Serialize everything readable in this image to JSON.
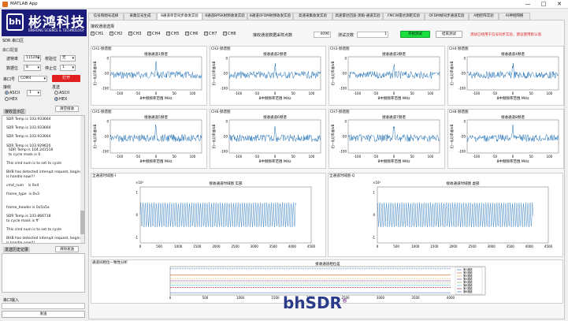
{
  "window": {
    "title": "MATLAB App",
    "minimize": "—",
    "maximize": "□",
    "close": "✕"
  },
  "logo": {
    "mark": "bh",
    "name_cn": "彬鸿科技",
    "name_en": "BINHONG SCIENCE & TECHNOLOGY"
  },
  "sidebar": {
    "section_title": "SDR 串口区",
    "serial_settings": "串口配置",
    "baud_label": "波特率",
    "baud_value": "115200",
    "parity_label": "校验位",
    "parity_value": "无",
    "databits_label": "数据位",
    "databits_value": "8",
    "stopbits_label": "停止位",
    "stopbits_value": "1",
    "port_label": "串口号",
    "port_value": "COM4",
    "open_button": "打开",
    "receive_label": "接收",
    "send_mode_label": "发送",
    "ascii_label": "ASCII",
    "hex_label": "HEX",
    "count_value": "1",
    "clear_button": "清空接收",
    "recv_area_title": "接收显示区",
    "log_lines": [
      "SDR Temp is 103.933664",
      "",
      "SDR Temp is 103.933664",
      "",
      "SDR Temp is 103.933664",
      "",
      "SDR Temp is 103.929620",
      "  SDR Temp is 104.241516",
      "  tx cycle mask is 0",
      "",
      "This cmd num is to set tx cycle",
      "",
      "BHB has detected interupt request, begin",
      "is handle now!!!",
      "",
      "cmd_num    is 0x4",
      "",
      "frame_type  is 0x3",
      "",
      "",
      "frame_header is 0x5a5a",
      "",
      "SDR Temp is 103.866718",
      "tx cycle mask is ff",
      "",
      "This cmd num is to set tx cycle",
      "",
      "BHB has detected interupt request, begin",
      "is handle now!!!",
      "",
      "cmd_num    is 0x4"
    ],
    "send_area_title": "发送历史记录",
    "clear_send_button": "清除发送",
    "input_label": "串口输入",
    "send_button": "发送"
  },
  "tabs": [
    "信号和图号选择",
    "采集信号生成",
    "8通道单音同步收发实验",
    "8通道BPSK射频收发实验",
    "8通道OFDM射频收发实验",
    "高速采集收发实验",
    "高速雷达回波-测角-通道实验",
    "FMCW雷达测距实验",
    "OFDM帧同步通道实验",
    "A相控阵实验",
    "AI神经网络"
  ],
  "active_tab": 2,
  "controls": {
    "channel_group": "接收通道选择",
    "channels": [
      "CH1",
      "CH2",
      "CH3",
      "CH4",
      "CH5",
      "CH6",
      "CH7",
      "CH8"
    ],
    "rate_label": "接收通道数据采样点数",
    "rate_value": "4096",
    "count_label": "测试次数",
    "count_value": "1",
    "start_button": "开始测试",
    "stop_button": "结束测试",
    "status_text": "测试已经用于信号同步实验，建议使用默认值"
  },
  "spectrum": {
    "ylabel": "归一化功率谱/dB",
    "xlabel": "8中频频率范围 MHz",
    "xticks": [
      "-100",
      "-50",
      "0",
      "50",
      "100"
    ],
    "yticks": [
      "0",
      "-50",
      "-100"
    ],
    "charts": [
      {
        "cap": "CH1-频谱图",
        "title": "接收通道1频谱"
      },
      {
        "cap": "CH2-频谱图",
        "title": "接收通道2频谱"
      },
      {
        "cap": "CH3-频谱图",
        "title": "接收通道3频谱"
      },
      {
        "cap": "CH4-频谱图",
        "title": "接收通道4频谱"
      },
      {
        "cap": "CH5-频谱图",
        "title": "接收通道5频谱"
      },
      {
        "cap": "CH6-频谱图",
        "title": "接收通道6频谱"
      },
      {
        "cap": "CH7-频谱图",
        "title": "接收通道7频谱"
      },
      {
        "cap": "CH8-频谱图",
        "title": "接收通道8频谱"
      }
    ]
  },
  "time_domain": {
    "charts": [
      {
        "cap": "全通道时域图-I",
        "title": "接收通道时域图 实部"
      },
      {
        "cap": "全通道时域图-Q",
        "title": "接收通道时域图 虚部"
      }
    ],
    "xticks": [
      "0",
      "500",
      "1000",
      "1500",
      "2000",
      "2500",
      "3000",
      "3500",
      "4000",
      "4500"
    ],
    "exponent": "×10⁴",
    "yticks": [
      "1",
      "0",
      "-1"
    ]
  },
  "phase": {
    "cap": "通道间相位一致性分析",
    "title": "接收通道相位差",
    "xticks": [
      "0",
      "500",
      "1000",
      "1500",
      "2000",
      "2500",
      "3000",
      "3500",
      "4000"
    ],
    "legend": [
      "第1通道",
      "第2通道",
      "第3通道",
      "第4通道",
      "第5通道",
      "第6通道",
      "第7通道",
      "第8通道"
    ],
    "colors": [
      "#1f5fc0",
      "#d9531e",
      "#edb120",
      "#7e2f8e",
      "#77ac30",
      "#4dbeee",
      "#a2142f",
      "#1f5fc0"
    ]
  },
  "footer_logo": {
    "text": "bhSDR",
    "mark": "®"
  }
}
